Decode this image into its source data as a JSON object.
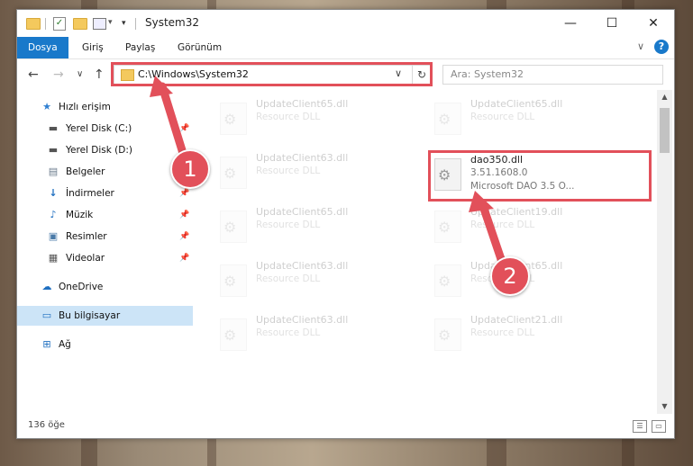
{
  "window": {
    "title": "System32",
    "tabs": [
      {
        "label": "Dosya",
        "active": true
      },
      {
        "label": "Giriş"
      },
      {
        "label": "Paylaş"
      },
      {
        "label": "Görünüm"
      }
    ],
    "controls": {
      "minimize": "—",
      "maximize": "☐",
      "close": "✕"
    },
    "help": "?"
  },
  "address": {
    "path": "C:\\Windows\\System32",
    "refresh_glyph": "↻",
    "chevron": "∨"
  },
  "search": {
    "placeholder": "Ara: System32"
  },
  "nav": {
    "back": "←",
    "forward": "→",
    "recent": "∨",
    "up": "↑"
  },
  "sidebar": {
    "items": [
      {
        "label": "Hızlı erişim",
        "icon": "star-icon"
      },
      {
        "label": "Yerel Disk (C:)",
        "icon": "drive-icon",
        "pinned": true
      },
      {
        "label": "Yerel Disk (D:)",
        "icon": "drive-icon",
        "pinned": true
      },
      {
        "label": "Belgeler",
        "icon": "documents-icon",
        "pinned": true
      },
      {
        "label": "İndirmeler",
        "icon": "download-icon",
        "pinned": true
      },
      {
        "label": "Müzik",
        "icon": "music-icon",
        "pinned": true
      },
      {
        "label": "Resimler",
        "icon": "pictures-icon",
        "pinned": true
      },
      {
        "label": "Videolar",
        "icon": "videos-icon",
        "pinned": true
      },
      {
        "label": "OneDrive",
        "icon": "cloud-icon"
      },
      {
        "label": "Bu bilgisayar",
        "icon": "computer-icon",
        "selected": true
      },
      {
        "label": "Ağ",
        "icon": "network-icon"
      }
    ]
  },
  "files": [
    {
      "name": "UpdateClient65.dll",
      "type": "Resource DLL",
      "faded": true
    },
    {
      "name": "UpdateClient65.dll",
      "type": "Resource DLL",
      "faded": true
    },
    {
      "name": "UpdateClient63.dll",
      "type": "Resource DLL",
      "faded": true
    },
    {
      "name": "dao350.dll",
      "version": "3.51.1608.0",
      "desc": "Microsoft DAO 3.5 O...",
      "faded": false
    },
    {
      "name": "UpdateClient65.dll",
      "type": "Resource DLL",
      "faded": true
    },
    {
      "name": "UpdateClient19.dll",
      "type": "Resource DLL",
      "faded": true
    },
    {
      "name": "UpdateClient63.dll",
      "type": "Resource DLL",
      "faded": true
    },
    {
      "name": "UpdateClient65.dll",
      "type": "Resource DLL",
      "faded": true
    },
    {
      "name": "UpdateClient63.dll",
      "type": "Resource DLL",
      "faded": true
    },
    {
      "name": "UpdateClient21.dll",
      "type": "Resource DLL",
      "faded": true
    }
  ],
  "status": {
    "count": "136 öğe"
  },
  "annotations": {
    "step1": "1",
    "step2": "2",
    "color": "#e2505a"
  }
}
